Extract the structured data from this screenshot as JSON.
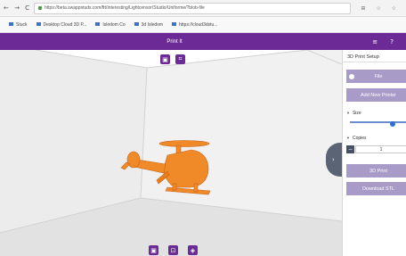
{
  "browser": {
    "nav_icons": "← → C",
    "url": "https://beta.swappstuds.com/ftt/Interesting/Lightcensor/Studio/Uniforme/?blob-file",
    "right_icons": "⊞ ☆ ☆"
  },
  "bookmarks": [
    {
      "label": "Stuck"
    },
    {
      "label": "Desktop Cloud 3D P..."
    },
    {
      "label": "Isledom Co"
    },
    {
      "label": "3d Isledom"
    },
    {
      "label": "https://cloud3dstu..."
    }
  ],
  "app": {
    "title": "Print It",
    "icons": "≡ ?",
    "accent": "#6c2a96",
    "button_color": "#a99bc7"
  },
  "viewer": {
    "top_buttons": [
      "▣",
      "⌗"
    ],
    "bottom_buttons": [
      "▣",
      "⊡",
      "◈"
    ],
    "toggle_arrow": "›",
    "model": "orange helicopter"
  },
  "panel": {
    "title": "3D Print Setup",
    "file_label": "File",
    "add_printer_label": "Add New Printer",
    "size_label": "Size",
    "copies_label": "Copies",
    "copies_value": "1",
    "copies_minus": "−",
    "print_label": "3D Print",
    "download_label": "Download STL"
  }
}
